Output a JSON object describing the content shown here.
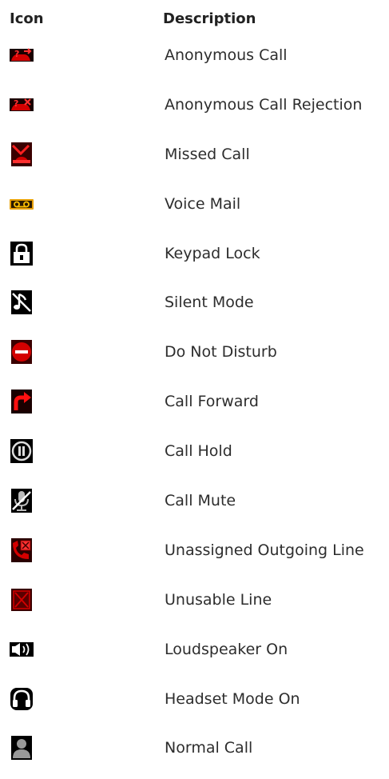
{
  "header": {
    "icon_label": "Icon",
    "description_label": "Description"
  },
  "rows": [
    {
      "icon": "anonymous-call-icon",
      "label": "Anonymous Call"
    },
    {
      "icon": "anonymous-call-rejection-icon",
      "label": "Anonymous Call Rejection"
    },
    {
      "icon": "missed-call-icon",
      "label": "Missed Call"
    },
    {
      "icon": "voice-mail-icon",
      "label": "Voice Mail"
    },
    {
      "icon": "keypad-lock-icon",
      "label": "Keypad Lock"
    },
    {
      "icon": "silent-mode-icon",
      "label": "Silent Mode"
    },
    {
      "icon": "do-not-disturb-icon",
      "label": "Do Not Disturb"
    },
    {
      "icon": "call-forward-icon",
      "label": "Call Forward"
    },
    {
      "icon": "call-hold-icon",
      "label": "Call Hold"
    },
    {
      "icon": "call-mute-icon",
      "label": "Call Mute"
    },
    {
      "icon": "unassigned-outgoing-line-icon",
      "label": "Unassigned Outgoing Line"
    },
    {
      "icon": "unusable-line-icon",
      "label": "Unusable Line"
    },
    {
      "icon": "loudspeaker-icon",
      "label": "Loudspeaker On"
    },
    {
      "icon": "headset-icon",
      "label": "Headset Mode On"
    },
    {
      "icon": "normal-call-icon",
      "label": "Normal Call"
    }
  ],
  "colors": {
    "icon_red": "#d40000",
    "icon_dark": "#000000",
    "voicemail_amber": "#e8a000"
  }
}
